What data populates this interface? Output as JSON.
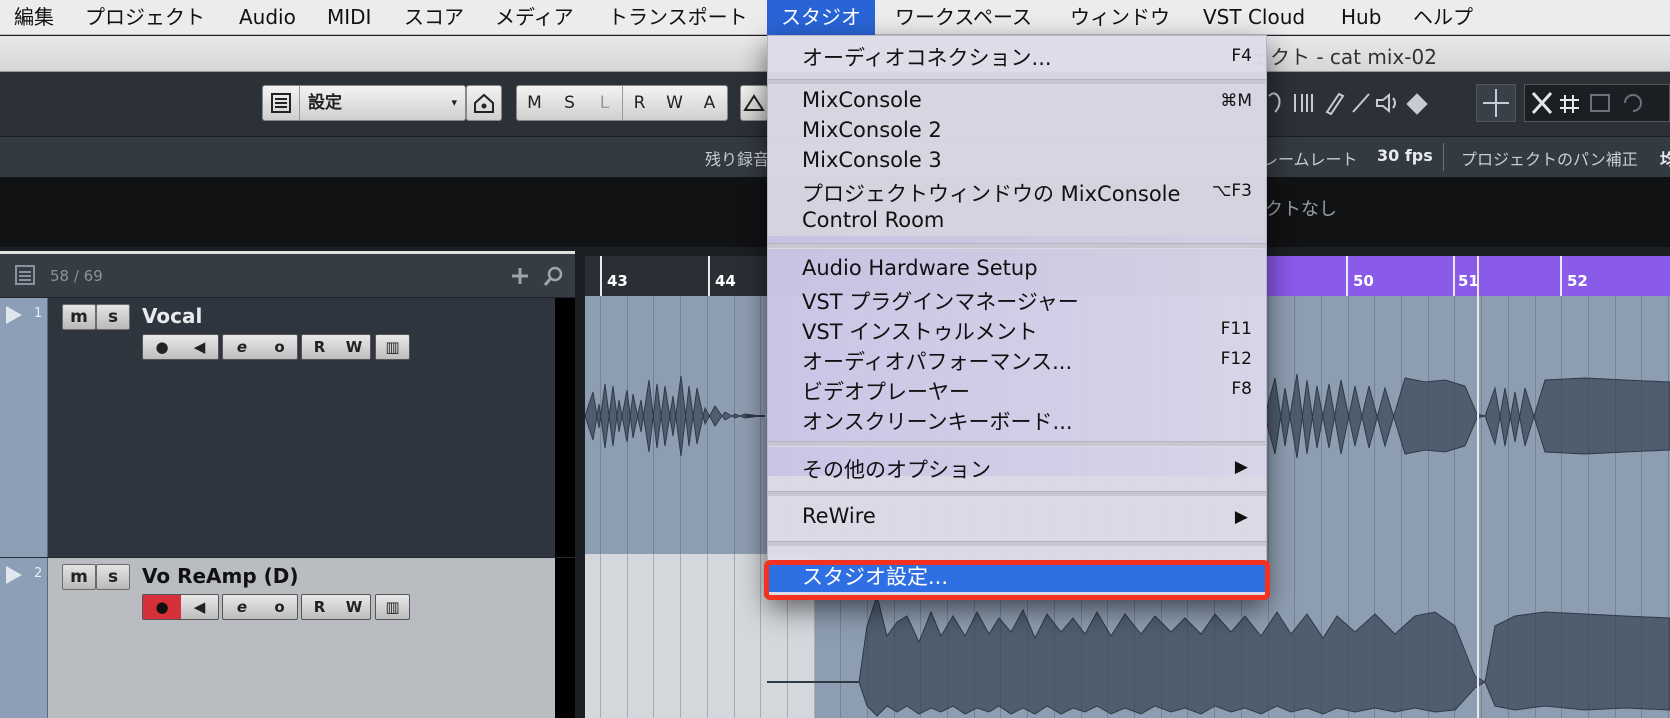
{
  "menubar": {
    "items": [
      "編集",
      "プロジェクト",
      "Audio",
      "MIDI",
      "スコア",
      "メディア",
      "トランスポート",
      "スタジオ",
      "ワークスペース",
      "ウィンドウ",
      "VST Cloud",
      "Hub",
      "ヘルプ"
    ],
    "active_index": 7
  },
  "window": {
    "title_fragment": "ェクト - cat mix-02"
  },
  "toolbar": {
    "preset_label": "設定",
    "mode_buttons": [
      "M",
      "S",
      "L",
      "R",
      "W",
      "A"
    ]
  },
  "infoline": {
    "remaining_label": "残り録音",
    "framerate_label": "レームレート",
    "framerate_value": "30 fps",
    "pan_label": "プロジェクトのパン補正",
    "trailing": "均"
  },
  "darkband": {
    "text": "クトなし"
  },
  "tracklist": {
    "count": "58 / 69",
    "tracks": [
      {
        "number": "1",
        "name": "Vocal",
        "record_armed": false
      },
      {
        "number": "2",
        "name": "Vo ReAmp (D)",
        "record_armed": true
      }
    ],
    "track_buttons": {
      "mute": "m",
      "solo": "s",
      "read": "R",
      "write": "W"
    }
  },
  "ruler": {
    "bars": [
      "43",
      "44",
      "50",
      "51",
      "52"
    ]
  },
  "studio_menu": {
    "items": [
      {
        "label": "オーディオコネクション...",
        "shortcut": "F4"
      },
      {
        "label": "MixConsole",
        "shortcut": "⌘M"
      },
      {
        "label": "MixConsole 2",
        "shortcut": ""
      },
      {
        "label": "MixConsole 3",
        "shortcut": ""
      },
      {
        "label": "プロジェクトウィンドウの MixConsole",
        "shortcut": "⌥F3"
      },
      {
        "label": "Control Room",
        "shortcut": ""
      },
      {
        "label": "Audio Hardware Setup",
        "shortcut": ""
      },
      {
        "label": "VST プラグインマネージャー",
        "shortcut": ""
      },
      {
        "label": "VST インストゥルメント",
        "shortcut": "F11"
      },
      {
        "label": "オーディオパフォーマンス...",
        "shortcut": "F12"
      },
      {
        "label": "ビデオプレーヤー",
        "shortcut": "F8"
      },
      {
        "label": "オンスクリーンキーボード...",
        "shortcut": ""
      },
      {
        "label": "その他のオプション",
        "shortcut": "▶"
      },
      {
        "label": "ReWire",
        "shortcut": "▶"
      },
      {
        "label": "スタジオ設定...",
        "shortcut": ""
      }
    ],
    "selected_index": 14
  },
  "colors": {
    "highlight": "#2f6fe4",
    "annotation": "#f43020",
    "record": "#d6313a",
    "ruler_loop": "#8a5ae8"
  }
}
